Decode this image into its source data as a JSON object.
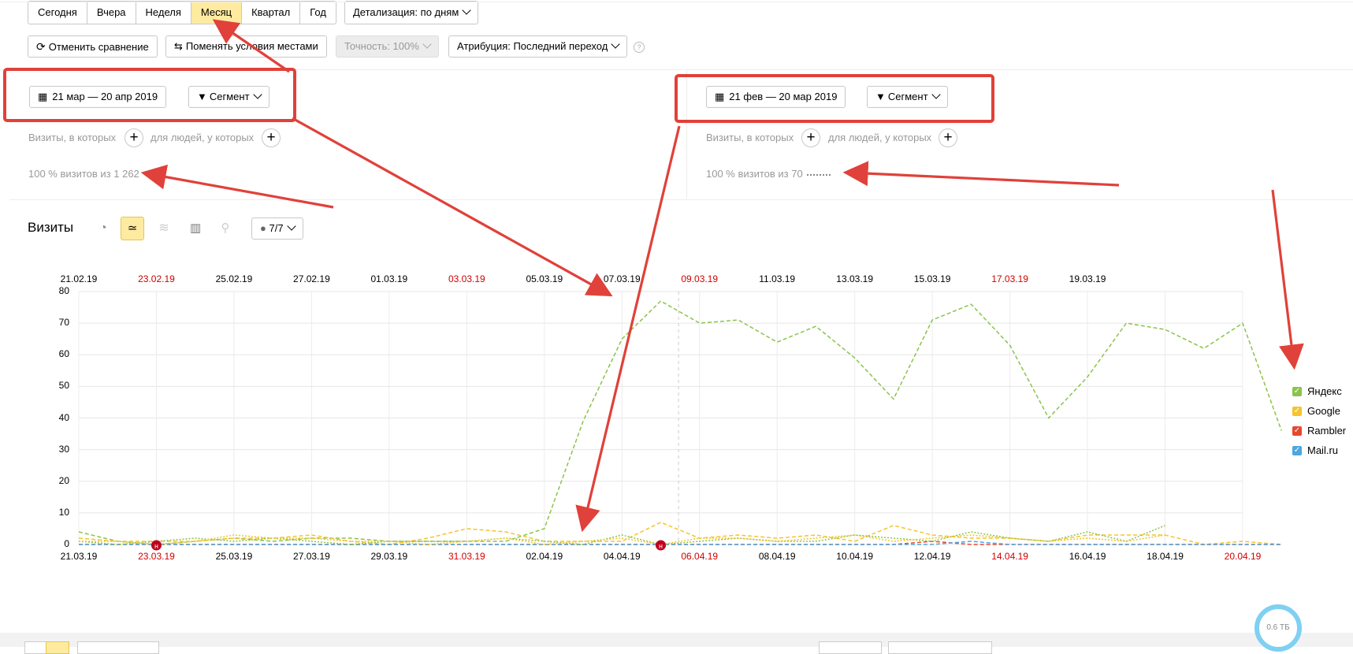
{
  "period_tabs": [
    "Сегодня",
    "Вчера",
    "Неделя",
    "Месяц",
    "Квартал",
    "Год"
  ],
  "active_period": "Месяц",
  "detail_label": "Детализация: по дням",
  "toolbar": {
    "cancel_compare": "Отменить сравнение",
    "swap_conditions": "Поменять условия местами",
    "accuracy": "Точность: 100%",
    "attribution": "Атрибуция: Последний переход",
    "help": "?"
  },
  "left_panel": {
    "date_range": "21 мар — 20 апр 2019",
    "segment": "Сегмент",
    "visits_label": "Визиты, в которых",
    "people_label": "для людей, у которых",
    "coverage": "100 % визитов из 1 262"
  },
  "right_panel": {
    "date_range": "21 фев — 20 мар 2019",
    "segment": "Сегмент",
    "visits_label": "Визиты, в которых",
    "people_label": "для людей, у которых",
    "coverage": "100 % визитов из 70"
  },
  "chart_header": {
    "title": "Визиты",
    "annotations": "7/7"
  },
  "badge": "0.6 ТБ",
  "colors": {
    "accent": "#ffeba0",
    "highlight": "#e0413a",
    "yandex": "#8bc34a",
    "google": "#f5c42c",
    "rambler": "#e8472e",
    "mailru": "#4da6e0",
    "weekend": "#d20000"
  },
  "chart_data": {
    "type": "line",
    "ylim": [
      0,
      80
    ],
    "yticks": [
      0,
      10,
      20,
      30,
      40,
      50,
      60,
      70,
      80
    ],
    "x_bottom": [
      "21.03.19",
      "22.03.19",
      "23.03.19",
      "24.03.19",
      "25.03.19",
      "26.03.19",
      "27.03.19",
      "28.03.19",
      "29.03.19",
      "30.03.19",
      "31.03.19",
      "01.04.19",
      "02.04.19",
      "03.04.19",
      "04.04.19",
      "05.04.19",
      "06.04.19",
      "07.04.19",
      "08.04.19",
      "09.04.19",
      "10.04.19",
      "11.04.19",
      "12.04.19",
      "13.04.19",
      "14.04.19",
      "15.04.19",
      "16.04.19",
      "17.04.19",
      "18.04.19",
      "19.04.19",
      "20.04.19"
    ],
    "x_top": [
      "21.02.19",
      "22.02.19",
      "23.02.19",
      "24.02.19",
      "25.02.19",
      "26.02.19",
      "27.02.19",
      "28.02.19",
      "01.03.19",
      "02.03.19",
      "03.03.19",
      "04.03.19",
      "05.03.19",
      "06.03.19",
      "07.03.19",
      "08.03.19",
      "09.03.19",
      "10.03.19",
      "11.03.19",
      "12.03.19",
      "13.03.19",
      "14.03.19",
      "15.03.19",
      "16.03.19",
      "17.03.19",
      "18.03.19",
      "19.03.19",
      "20.03.19"
    ],
    "bottom_tick_labels": [
      "21.03.19",
      "23.03.19",
      "25.03.19",
      "27.03.19",
      "29.03.19",
      "31.03.19",
      "02.04.19",
      "04.04.19",
      "06.04.19",
      "08.04.19",
      "10.04.19",
      "12.04.19",
      "14.04.19",
      "16.04.19",
      "18.04.19",
      "20.04.19"
    ],
    "bottom_red": [
      "23.03.19",
      "31.03.19",
      "06.04.19",
      "14.04.19",
      "20.04.19"
    ],
    "top_tick_labels": [
      "21.02.19",
      "23.02.19",
      "25.02.19",
      "27.02.19",
      "01.03.19",
      "03.03.19",
      "05.03.19",
      "07.03.19",
      "09.03.19",
      "11.03.19",
      "13.03.19",
      "15.03.19",
      "17.03.19",
      "19.03.19"
    ],
    "top_red": [
      "23.02.19",
      "03.03.19",
      "09.03.19",
      "17.03.19"
    ],
    "series": [
      {
        "name": "Яндекс",
        "period": "main",
        "values": [
          4,
          1,
          0,
          1,
          2,
          1,
          2,
          2,
          1,
          1,
          1,
          1,
          5,
          39,
          65,
          77,
          70,
          71,
          64,
          69,
          59,
          46,
          71,
          76,
          63,
          40,
          53,
          70,
          68,
          62,
          70,
          36
        ]
      },
      {
        "name": "Google",
        "period": "main",
        "values": [
          2,
          1,
          1,
          1,
          2,
          2,
          3,
          1,
          0,
          2,
          5,
          4,
          1,
          1,
          1,
          7,
          2,
          3,
          2,
          3,
          1,
          6,
          3,
          2,
          2,
          1,
          3,
          3,
          3,
          0,
          1,
          0
        ]
      },
      {
        "name": "Rambler",
        "period": "main",
        "values": [
          0,
          0,
          0,
          0,
          0,
          0,
          0,
          0,
          0,
          0,
          0,
          0,
          0,
          0,
          0,
          0,
          0,
          0,
          0,
          0,
          0,
          0,
          1,
          0,
          0,
          0,
          0,
          0,
          0,
          0,
          0,
          0
        ]
      },
      {
        "name": "Mail.ru",
        "period": "main",
        "values": [
          0,
          0,
          0,
          0,
          0,
          0,
          0,
          0,
          0,
          0,
          0,
          0,
          0,
          0,
          0,
          0,
          0,
          0,
          0,
          0,
          0,
          0,
          0,
          1,
          0,
          0,
          0,
          0,
          0,
          0,
          0,
          0
        ]
      },
      {
        "name": "Яндекс",
        "period": "compare",
        "values": [
          1,
          0,
          1,
          2,
          1,
          2,
          1,
          0,
          1,
          1,
          1,
          2,
          1,
          0,
          3,
          0,
          1,
          2,
          1,
          1,
          3,
          2,
          1,
          4,
          2,
          1,
          4,
          1,
          6
        ]
      },
      {
        "name": "Google",
        "period": "compare",
        "values": [
          1,
          1,
          0,
          1,
          3,
          2,
          2,
          1,
          1,
          0,
          1,
          2,
          0,
          1,
          2,
          0,
          2,
          2,
          1,
          2,
          3,
          1,
          2,
          3,
          2,
          1,
          2,
          1,
          3
        ]
      }
    ],
    "markers": [
      {
        "label": "н",
        "x": "23.03.19"
      },
      {
        "label": "н",
        "x": "05.04.19"
      }
    ],
    "legend": [
      "Яндекс",
      "Google",
      "Rambler",
      "Mail.ru"
    ],
    "legend_placement": "right"
  }
}
